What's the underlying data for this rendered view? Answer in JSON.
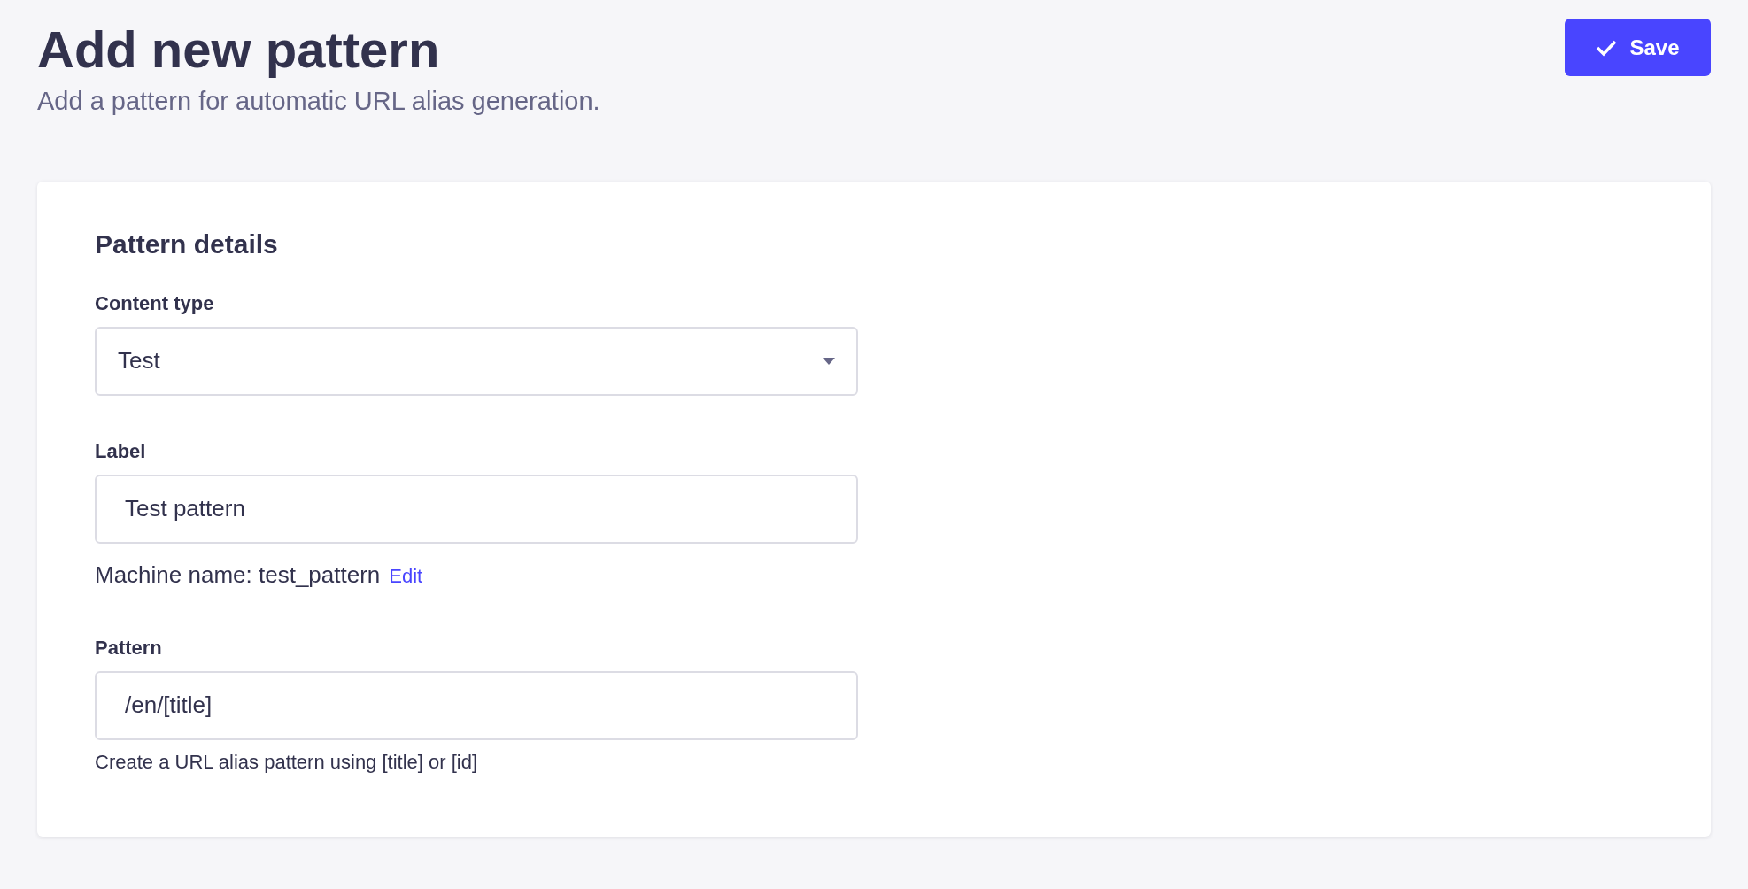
{
  "header": {
    "title": "Add new pattern",
    "subtitle": "Add a pattern for automatic URL alias generation."
  },
  "save_button": {
    "label": "Save"
  },
  "card": {
    "title": "Pattern details",
    "fields": [
      {
        "kind": "select",
        "label": "Content type",
        "value": "Test"
      },
      {
        "kind": "text",
        "label": "Label",
        "value": "Test pattern",
        "note": "Machine name: test_pattern",
        "link": "Edit"
      },
      {
        "kind": "text",
        "label": "Pattern",
        "value": "/en/[title]",
        "hint": "Create a URL alias pattern using [title] or [id]"
      }
    ]
  }
}
